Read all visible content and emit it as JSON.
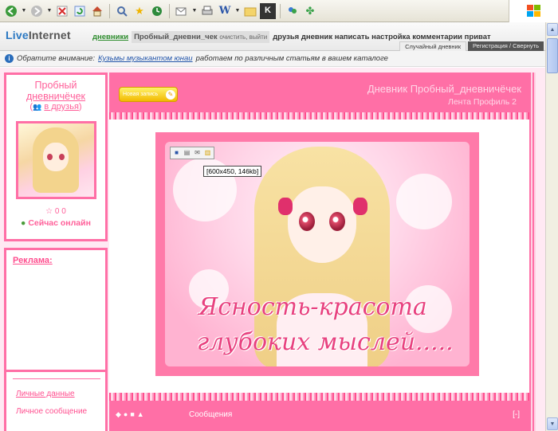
{
  "browser": {
    "toolbar_icons": [
      "back-icon",
      "back-dropdown-icon",
      "forward-icon",
      "forward-dropdown-icon",
      "stop-icon",
      "refresh-icon",
      "home-icon",
      "search-icon",
      "favorites-icon",
      "history-icon",
      "mail-icon",
      "print-icon",
      "edit-icon",
      "folder-icon",
      "k-icon",
      "messenger-icon",
      "clover-icon"
    ]
  },
  "header": {
    "logo_live": "Live",
    "logo_internet": "Internet",
    "diaries": "дневники",
    "user_tab": "Пробный_дневни_чек",
    "user_tab_small": "очистить, выйти",
    "nav_links": "друзья дневник написать настройка комментарии приват",
    "tab_random": "Случайный дневник",
    "tab_register": "Регистрация / Свернуть"
  },
  "notice": {
    "label": "Обратите внимание:",
    "link": "Кузьмы музыкантом юнаи",
    "text": "работаем по различным статьям в вашем каталоге"
  },
  "profile": {
    "name_line1": "Пробный",
    "name_line2": "дневничёчек",
    "add_friend": "в друзья",
    "stats": "0  0",
    "online": "Сейчас онлайн"
  },
  "ads": {
    "title": "Реклама:"
  },
  "menu": {
    "item1": "Личные данные",
    "item2": "Личное сообщение"
  },
  "diary": {
    "new_post": "Новая запись",
    "title": "Дневник Пробный_дневничёчек",
    "links": "Лента  Профиль  2"
  },
  "post": {
    "image_size": "[600x450, 146kb]",
    "caption_line1": "Ясность-красота",
    "caption_line2": "глубоких  мыслей.....",
    "footer_text": "Сообщения",
    "footer_count": "[-]"
  },
  "colors": {
    "accent_pink": "#ff6fa6",
    "text_pink": "#ff5f99",
    "caption_pink": "#e8417f"
  }
}
